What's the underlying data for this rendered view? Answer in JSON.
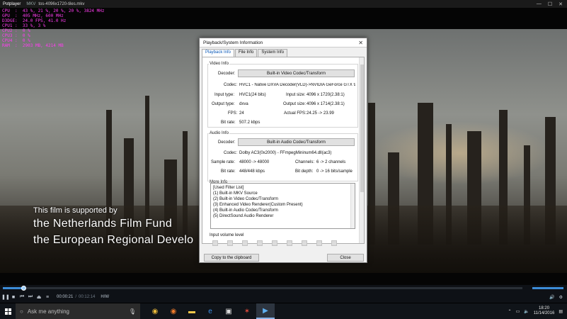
{
  "titlebar": {
    "app": "Potplayer",
    "container": "MKV",
    "filename": "tos-4096x1720-tiles.mkv",
    "min": "—",
    "max": "☐",
    "close": "✕"
  },
  "osd": [
    "CPU  :  43 %, 21 %, 20 %, 20 %, 3824 MHz",
    "GPU  :  405 MHz, 600 MHz",
    "D3DGE:  24.0 FPS, 41.0 Hz",
    "CPU1 :  33 %, 3 %",
    "CPU2 :  0 %",
    "CPU3 :  0 %",
    "CPU4 :  0 %",
    "RAM  :  2903 MB, 4214 MB"
  ],
  "subtitle": {
    "line1": "This film is supported by",
    "line2": "the Netherlands Film Fund",
    "line3": "the European Regional Develo"
  },
  "dialog": {
    "title": "Playback/System Information",
    "close": "✕",
    "tabs": [
      "Playback Info",
      "File Info",
      "System Info"
    ],
    "video": {
      "heading": "Video Info",
      "decoder_label": "Decoder:",
      "decoder_button": "Built-in Video Codec/Transform",
      "codec_label": "Codec:",
      "codec_value": "HVC1 - Native DXVA Decoder(VLD)->NVIDIA GeForce GTX 9t",
      "input_type_label": "Input type:",
      "input_type_value": "HVC1(24 bits)",
      "input_size_label": "Input size:",
      "input_size_value": "4096 x 1720(2.38:1)",
      "output_type_label": "Output type:",
      "output_type_value": "dxva",
      "output_size_label": "Output size:",
      "output_size_value": "4096 x 1714(2.38:1)",
      "fps_label": "FPS:",
      "fps_value": "24",
      "actual_fps_label": "Actual FPS:",
      "actual_fps_value": "24.25 -> 23.99",
      "bitrate_label": "Bit rate:",
      "bitrate_value": "507.2 kbps"
    },
    "audio": {
      "heading": "Audio Info",
      "decoder_label": "Decoder:",
      "decoder_button": "Built-in Audio Codec/Transform",
      "codec_label": "Codec:",
      "codec_value": "Dolby AC3(0x2000) - FFmpegMininum64.dll(ac3)",
      "sample_rate_label": "Sample rate:",
      "sample_rate_value": "48000 -> 48000",
      "channels_label": "Channels:",
      "channels_value": "6 -> 2 channels",
      "bitrate_label": "Bit rate:",
      "bitrate_value": "448/448 kbps",
      "bitdepth_label": "Bit depth:",
      "bitdepth_value": "0 -> 16 bits/sample"
    },
    "more": {
      "heading": "More Info",
      "lines": [
        "[Used Filter List]",
        "(1) Built-in MKV Source",
        "(2) Built-in Video Codec/Transform",
        "(3) Enhanced Video Renderer(Custom Present)",
        "(4) Built-in Audio Codec/Transform",
        "(5) DirectSound Audio Renderer"
      ]
    },
    "input_volume_label": "Input volume level",
    "copy_button": "Copy to the clipboard",
    "close_button": "Close"
  },
  "player": {
    "progress": 0.04,
    "time_current": "00:00:21",
    "time_total": "00:12:14",
    "hw_label": "H/W",
    "volume": 1.0
  },
  "taskbar": {
    "search_placeholder": "Ask me anything",
    "time": "18:20",
    "date": "11/14/2016"
  }
}
